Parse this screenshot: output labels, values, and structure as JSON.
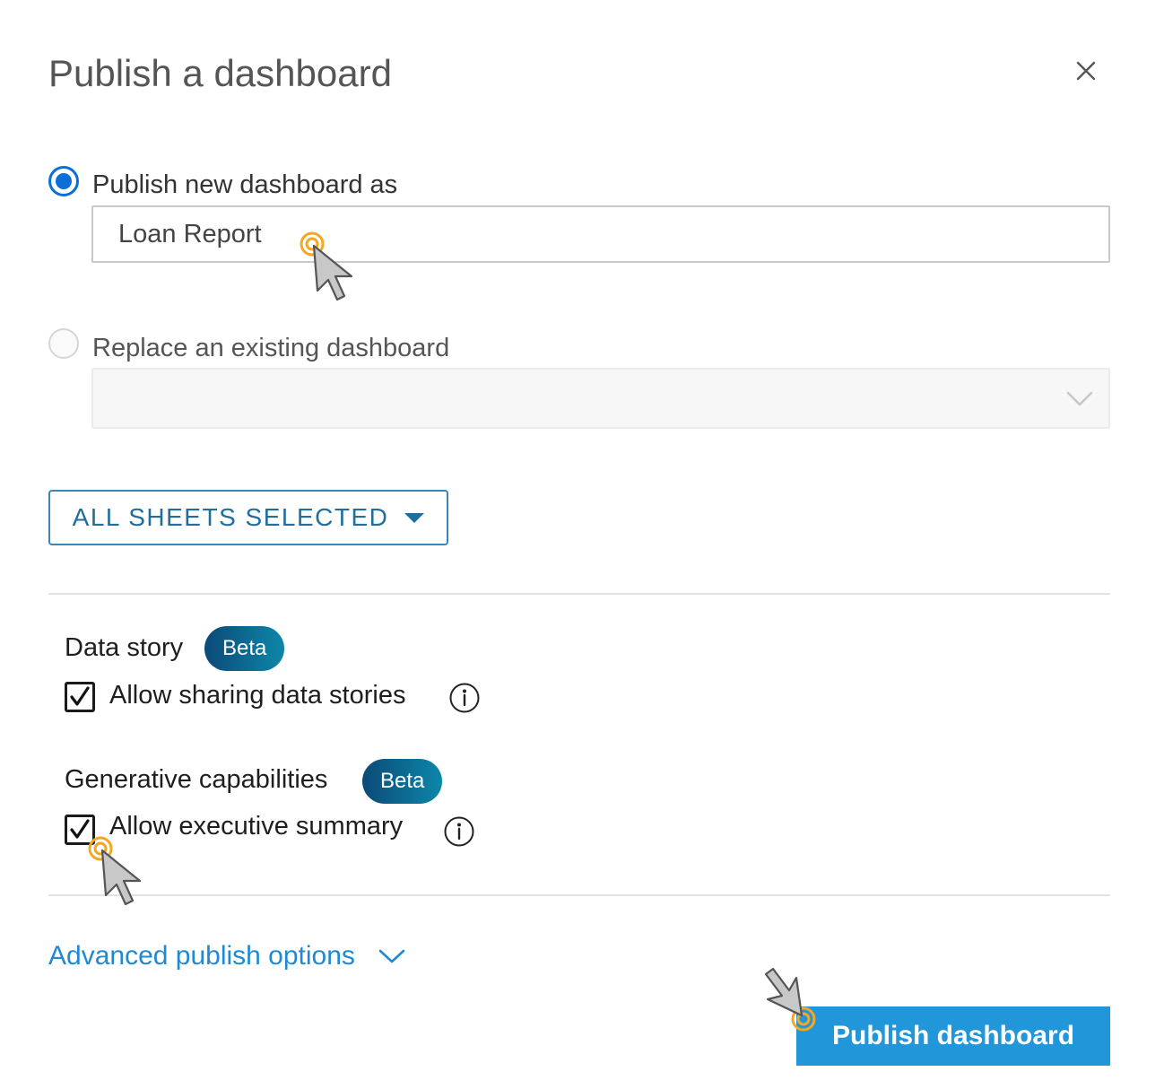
{
  "dialog": {
    "title": "Publish a dashboard",
    "close_icon": "close-icon"
  },
  "publish_new": {
    "label": "Publish new dashboard as",
    "selected": true,
    "name_value": "Loan Report"
  },
  "replace_existing": {
    "label": "Replace an existing dashboard",
    "selected": false,
    "selected_value": ""
  },
  "sheets_button": {
    "label": "ALL SHEETS SELECTED"
  },
  "data_story": {
    "title": "Data story",
    "badge": "Beta",
    "checkbox_label": "Allow sharing data stories",
    "checked": true
  },
  "generative": {
    "title": "Generative capabilities",
    "badge": "Beta",
    "checkbox_label": "Allow executive summary",
    "checked": true
  },
  "advanced_link": {
    "label": "Advanced publish options"
  },
  "publish_button": {
    "label": "Publish dashboard"
  },
  "colors": {
    "accent": "#2196d8",
    "radio": "#0a6fd6",
    "link": "#1f8ad2",
    "sheets_text": "#1f6e9e",
    "badge_start": "#0b4a78",
    "badge_end": "#0d87a9",
    "click_ring": "#f5a623"
  }
}
